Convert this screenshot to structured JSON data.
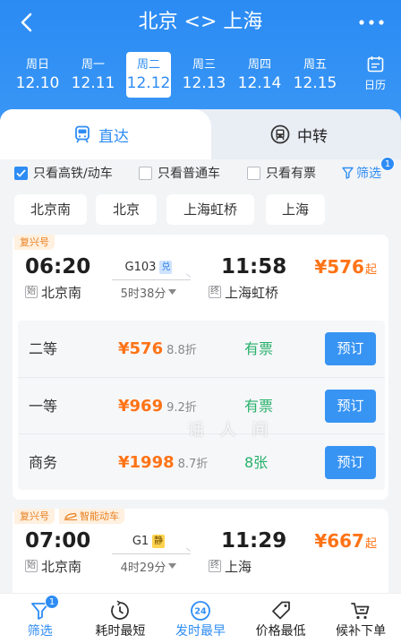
{
  "colors": {
    "primary": "#2e8cf4",
    "header_bg": "#2b8bf3",
    "price": "#ff7316",
    "available": "#27b06a",
    "button_bg": "#3894f3",
    "tag_bg": "#fff0df",
    "tag_text": "#e98020",
    "badge_blue": "#2d7fe6",
    "badge_yellow": "#ffd34d"
  },
  "header": {
    "title": "北京 <> 上海",
    "back_icon": "chevron-left-icon",
    "more_icon": "more-dots-icon"
  },
  "dates": [
    {
      "weekday": "周日",
      "date": "12.10",
      "selected": false
    },
    {
      "weekday": "周一",
      "date": "12.11",
      "selected": false
    },
    {
      "weekday": "周二",
      "date": "12.12",
      "selected": true
    },
    {
      "weekday": "周三",
      "date": "12.13",
      "selected": false
    },
    {
      "weekday": "周四",
      "date": "12.14",
      "selected": false
    },
    {
      "weekday": "周五",
      "date": "12.15",
      "selected": false
    }
  ],
  "calendar": {
    "label": "日历",
    "icon": "calendar-icon"
  },
  "tabs": [
    {
      "label": "直达",
      "icon": "train-icon",
      "active": true
    },
    {
      "label": "中转",
      "icon": "transfer-bus-icon",
      "active": false
    }
  ],
  "filters": [
    {
      "label": "只看高铁/动车",
      "checked": true
    },
    {
      "label": "只看普通车",
      "checked": false
    },
    {
      "label": "只看有票",
      "checked": false
    }
  ],
  "filter_button": {
    "label": "筛选",
    "badge": "1",
    "icon": "funnel-icon"
  },
  "stations": [
    "北京南",
    "北京",
    "上海虹桥",
    "上海"
  ],
  "trains": [
    {
      "tags": [
        {
          "label": "复兴号"
        }
      ],
      "depart_time": "06:20",
      "train_no": "G103",
      "badge": "兑",
      "arrive_time": "11:58",
      "price": "¥576",
      "price_suffix": "起",
      "from_tag": "始",
      "from": "北京南",
      "duration": "5时38分",
      "to_tag": "终",
      "to": "上海虹桥",
      "seats": [
        {
          "seat_class": "二等",
          "price": "¥576",
          "discount": "8.8折",
          "availability": "有票",
          "action": "预订"
        },
        {
          "seat_class": "一等",
          "price": "¥969",
          "discount": "9.2折",
          "availability": "有票",
          "action": "预订"
        },
        {
          "seat_class": "商务",
          "price": "¥1998",
          "discount": "8.7折",
          "availability": "8张",
          "action": "预订"
        }
      ]
    },
    {
      "tags": [
        {
          "label": "复兴号"
        },
        {
          "label": "智能动车",
          "icon": "smart-train-icon"
        }
      ],
      "depart_time": "07:00",
      "train_no": "G1",
      "badge": "静",
      "arrive_time": "11:29",
      "price": "¥667",
      "price_suffix": "起",
      "from_tag": "始",
      "from": "北京南",
      "duration": "4时29分",
      "to_tag": "终",
      "to": "上海"
    }
  ],
  "watermark": "话 人 间",
  "bottom_nav": [
    {
      "label": "筛选",
      "icon": "funnel-icon",
      "badge": "1",
      "active": true
    },
    {
      "label": "耗时最短",
      "icon": "clock-icon",
      "active": false
    },
    {
      "label": "发时最早",
      "icon": "clock-24-icon",
      "icon_text": "24",
      "active": true
    },
    {
      "label": "价格最低",
      "icon": "price-tag-icon",
      "active": false
    },
    {
      "label": "候补下单",
      "icon": "cart-icon",
      "active": false
    }
  ]
}
